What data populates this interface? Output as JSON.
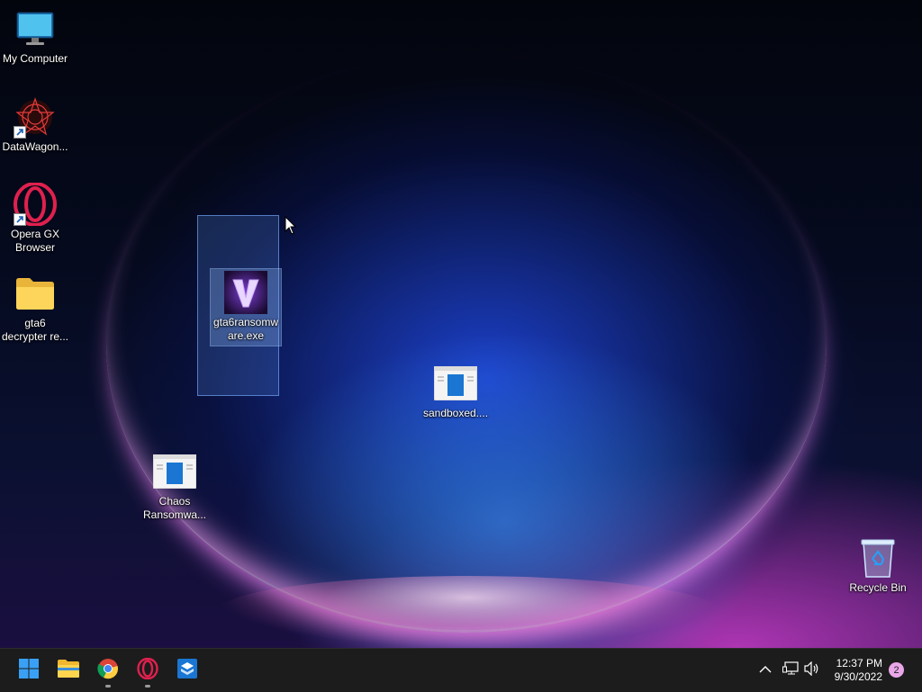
{
  "desktop": {
    "icons": {
      "my_computer": {
        "label": "My Computer"
      },
      "datawagon": {
        "label": "DataWagon..."
      },
      "opera_gx": {
        "label": "Opera GX Browser"
      },
      "gta6_folder": {
        "label": "gta6 decrypter re..."
      },
      "gta6_exe": {
        "label": "gta6ransomware.exe"
      },
      "sandboxed": {
        "label": "sandboxed...."
      },
      "chaos": {
        "label": "Chaos Ransomwa..."
      },
      "recycle_bin": {
        "label": "Recycle Bin"
      }
    }
  },
  "taskbar": {
    "apps": [
      "start-icon",
      "file-explorer-icon",
      "chrome-icon",
      "opera-gx-icon",
      "sandbox-app-icon"
    ],
    "clock": {
      "time": "12:37 PM",
      "date": "9/30/2022"
    },
    "notification_count": "2"
  },
  "colors": {
    "taskbar_bg": "#1c1c1c",
    "accent": "#0078d4",
    "badge": "#e9a7e8"
  }
}
